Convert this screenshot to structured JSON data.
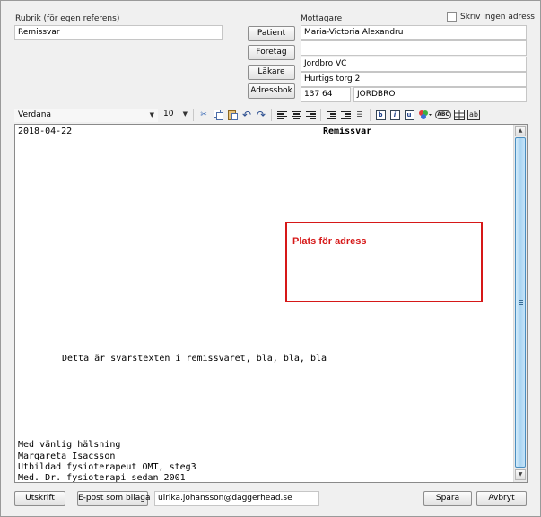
{
  "header": {
    "subject_label": "Rubrik (för egen referens)",
    "subject_value": "Remissvar",
    "recipient_label": "Mottagare",
    "no_address_label": "Skriv ingen adress"
  },
  "recipient_buttons": {
    "patient": "Patient",
    "company": "Företag",
    "doctor": "Läkare",
    "address_book": "Adressbok"
  },
  "recipient": {
    "name": "Maria-Victoria Alexandru",
    "line2": "",
    "org": "Jordbro VC",
    "street": "Hurtigs torg 2",
    "postal_code": "137 64",
    "city": "JORDBRO"
  },
  "toolbar": {
    "font": "Verdana",
    "size": "10",
    "icons": [
      "cut-icon",
      "copy-icon",
      "paste-icon",
      "undo-icon",
      "redo-icon",
      "align-left-icon",
      "align-center-icon",
      "align-right-icon",
      "outdent-icon",
      "indent-icon",
      "bullet-list-icon",
      "bold-icon",
      "italic-icon",
      "underline-icon",
      "color-icon",
      "spellcheck-icon",
      "table-icon",
      "textbox-icon"
    ],
    "bold": "b",
    "italic": "i",
    "underline": "u",
    "spellcheck": "ABC",
    "textbox": "ab"
  },
  "document": {
    "date": "2018-04-22",
    "title": "Remissvar",
    "address_placeholder": "Plats för adress",
    "body": "Detta är svarstexten i remissvaret, bla, bla, bla",
    "signature": [
      "Med vänlig hälsning",
      "Margareta Isacsson",
      "Utbildad fysioterapeut OMT, steg3",
      "Med. Dr. fysioterapi sedan 2001"
    ]
  },
  "footer": {
    "print": "Utskrift",
    "email_attachment": "E-post som bilaga",
    "email": "ulrika.johansson@daggerhead.se",
    "save": "Spara",
    "cancel": "Avbryt"
  }
}
